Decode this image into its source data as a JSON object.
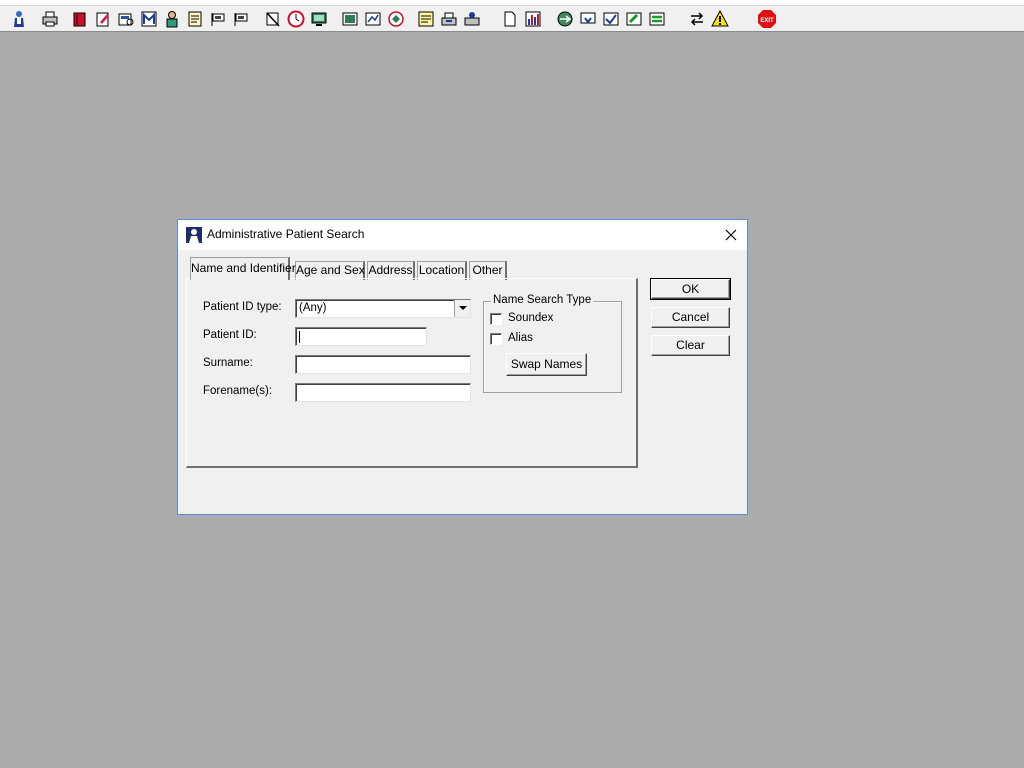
{
  "toolbar": {
    "icons": [
      "patient-icon",
      "printer-icon",
      "book-icon",
      "edit-doc-icon",
      "find-doc-icon",
      "letter-m-icon",
      "doctor-icon",
      "form-icon",
      "flag-icon",
      "flag-icon",
      "cross-doc-icon",
      "clock-icon",
      "monitor-icon",
      "picture-icon",
      "chart-doc-icon",
      "globe-doc-icon",
      "note-icon",
      "printer-queue-icon",
      "printer-user-icon",
      "page-icon",
      "bar-chart-icon",
      "globe-arrow-icon",
      "mail-down-icon",
      "check-doc-icon",
      "green-arrow-doc-icon",
      "green-arrows-doc-icon",
      "swap-icon",
      "warning-icon",
      "exit-icon"
    ]
  },
  "dialog": {
    "title": "Administrative Patient Search",
    "tabs": [
      {
        "label": "Name and Identifier",
        "active": true
      },
      {
        "label": "Age and Sex",
        "active": false
      },
      {
        "label": "Address",
        "active": false
      },
      {
        "label": "Location",
        "active": false
      },
      {
        "label": "Other",
        "active": false
      }
    ],
    "fields": {
      "patient_id_type_label": "Patient ID type:",
      "patient_id_type_value": "(Any)",
      "patient_id_label": "Patient ID:",
      "patient_id_value": "",
      "surname_label": "Surname:",
      "surname_value": "",
      "forename_label": "Forename(s):",
      "forename_value": ""
    },
    "name_search": {
      "title": "Name Search Type",
      "soundex_label": "Soundex",
      "soundex_checked": false,
      "alias_label": "Alias",
      "alias_checked": false,
      "swap_label": "Swap Names"
    },
    "buttons": {
      "ok": "OK",
      "cancel": "Cancel",
      "clear": "Clear"
    }
  },
  "colors": {
    "desktop": "#ababab",
    "dialog": "#f0f0f0",
    "titlebar": "#ffffff",
    "accent_border": "#5a8ed6"
  }
}
